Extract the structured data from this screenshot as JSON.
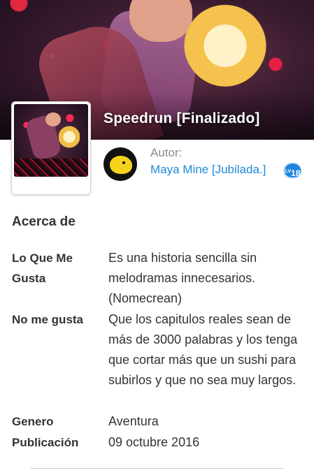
{
  "story": {
    "title": "Speedrun [Finalizado]"
  },
  "author": {
    "label": "Autor:",
    "name": "Maya Mine [Jubilada.]",
    "level_prefix": "LV",
    "level": "18"
  },
  "about": {
    "heading": "Acerca de",
    "rows": [
      {
        "label": "Lo Que Me Gusta",
        "value": "Es una historia sencilla sin melodramas innecesarios. (Nomecrean)"
      },
      {
        "label": "No me gusta",
        "value": "Que los capitulos reales sean de más de 3000 palabras y los tenga que cortar más que un sushi para subirlos y que no sea muy largos."
      },
      {
        "label": "Genero",
        "value": "Aventura"
      },
      {
        "label": "Publicación",
        "value": "09 octubre 2016"
      }
    ]
  },
  "colors": {
    "link": "#1e8ad6",
    "badge": "#1f84dc"
  }
}
